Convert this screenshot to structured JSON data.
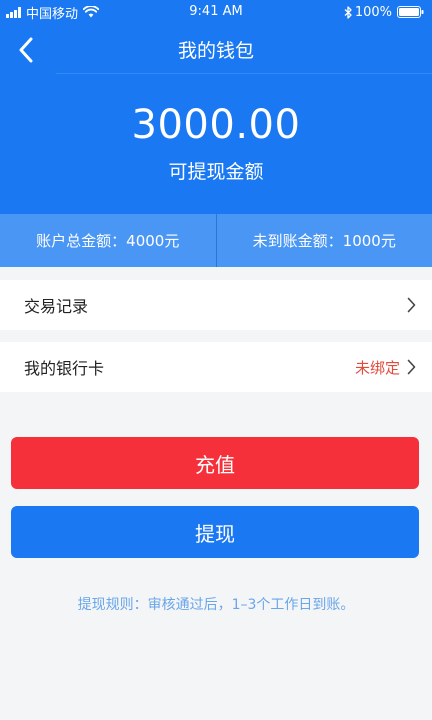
{
  "status_bar": {
    "carrier": "中国移动",
    "time": "9:41 AM",
    "battery": "100%"
  },
  "nav": {
    "title": "我的钱包",
    "back_icon": "chevron-left-icon"
  },
  "balance": {
    "amount": "3000.00",
    "label": "可提现金额"
  },
  "summary": {
    "total": "账户总金额：4000元",
    "pending": "未到账金额：1000元"
  },
  "menu": {
    "transactions_label": "交易记录",
    "bank_card_label": "我的银行卡",
    "bank_card_status": "未绑定"
  },
  "actions": {
    "recharge_label": "充值",
    "withdraw_label": "提现"
  },
  "rules": "提现规则：审核通过后，1–3个工作日到账。",
  "colors": {
    "primary": "#1a78f2",
    "summary_bg": "#4a96f4",
    "danger": "#f5303a",
    "status_red": "#e24a3b",
    "hint": "#6aa6ea",
    "page_bg": "#f4f5f7"
  }
}
